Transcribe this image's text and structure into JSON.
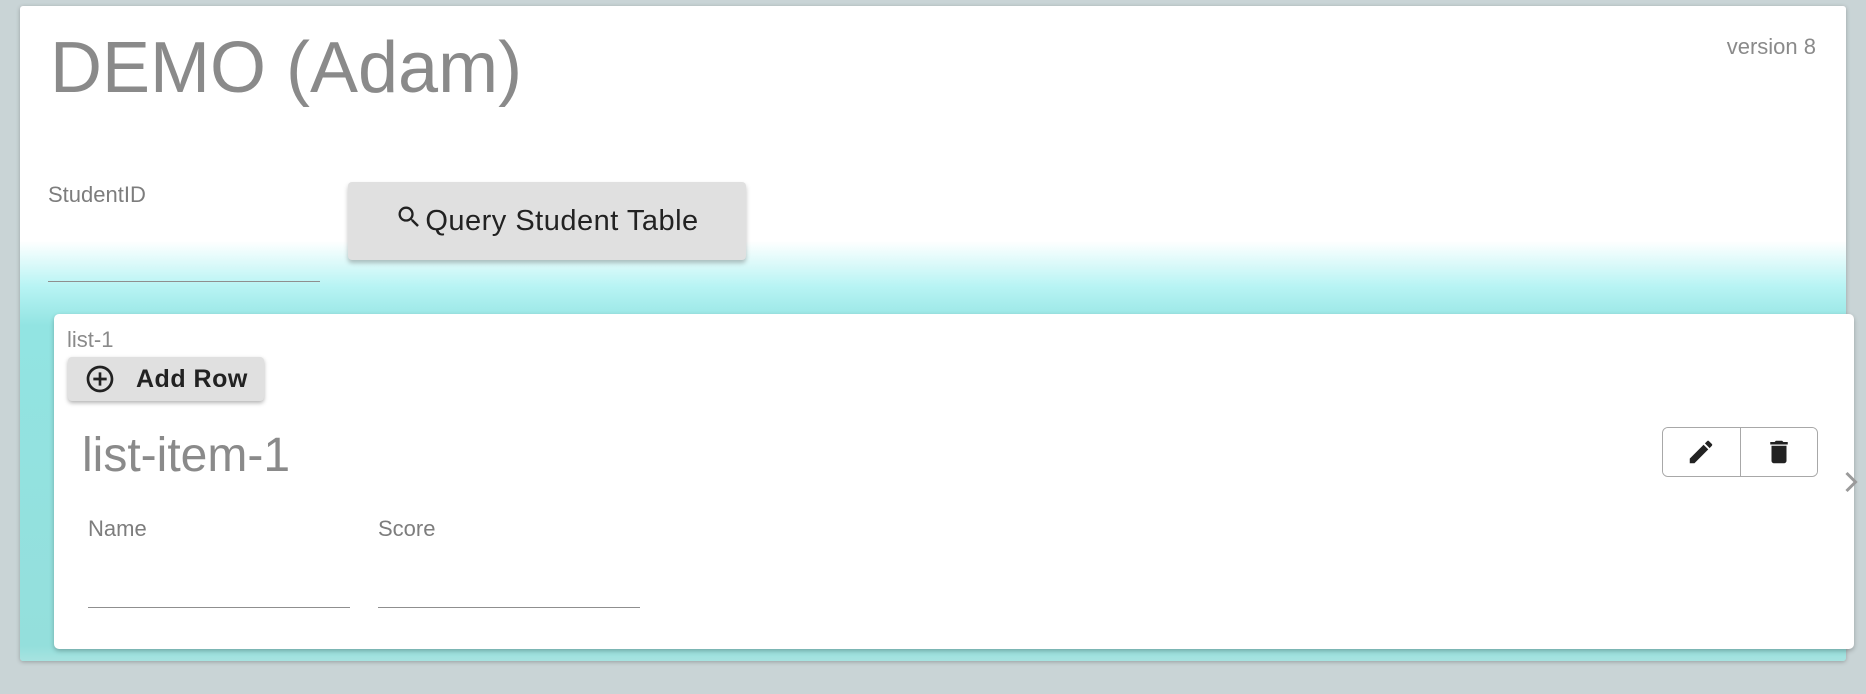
{
  "header": {
    "title": "DEMO (Adam)",
    "version": "version 8"
  },
  "form": {
    "student_id": {
      "label": "StudentID",
      "value": "",
      "placeholder": ""
    },
    "query_button": {
      "label": "Query Student Table",
      "icon": "search-icon"
    }
  },
  "list": {
    "label": "list-1",
    "add_row_button": {
      "label": "Add Row",
      "icon": "add-circle-icon"
    },
    "items": [
      {
        "title": "list-item-1",
        "actions": [
          {
            "name": "edit",
            "icon": "pencil-icon"
          },
          {
            "name": "delete",
            "icon": "trash-icon"
          }
        ],
        "fields": {
          "name": {
            "label": "Name",
            "value": "",
            "placeholder": ""
          },
          "score": {
            "label": "Score",
            "value": "",
            "placeholder": ""
          }
        }
      }
    ]
  },
  "colors": {
    "accent_glow": "#92e4e2",
    "button_bg": "#e0e0e0",
    "muted_text": "#8a8a8a"
  }
}
